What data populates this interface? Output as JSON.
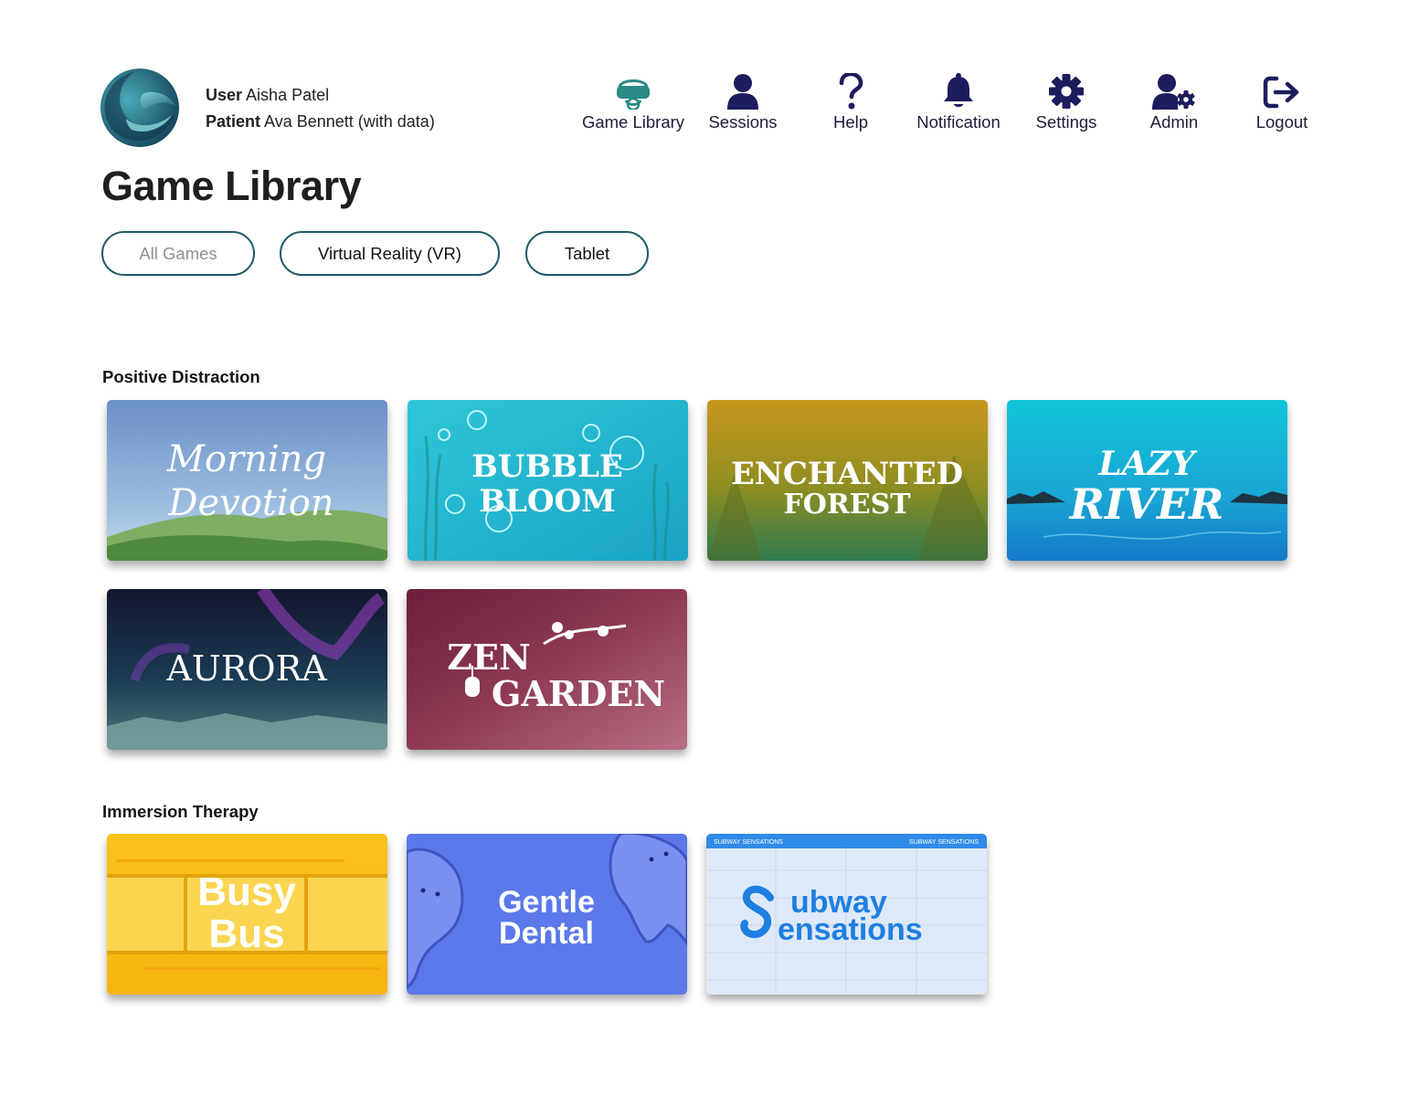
{
  "header": {
    "user_label": "User",
    "user_name": "Aisha Patel",
    "patient_label": "Patient",
    "patient_name": "Ava Bennett (with data)"
  },
  "nav": [
    {
      "label": "Game Library",
      "icon": "vr-headset-icon",
      "active": true,
      "color": "#2a8a86"
    },
    {
      "label": "Sessions",
      "icon": "user-icon"
    },
    {
      "label": "Help",
      "icon": "question-icon"
    },
    {
      "label": "Notification",
      "icon": "bell-icon"
    },
    {
      "label": "Settings",
      "icon": "gear-icon"
    },
    {
      "label": "Admin",
      "icon": "user-gear-icon"
    },
    {
      "label": "Logout",
      "icon": "logout-icon"
    }
  ],
  "page_title": "Game Library",
  "filters": [
    {
      "label": "All Games",
      "state": "inactive"
    },
    {
      "label": "Virtual Reality (VR)",
      "state": "active"
    },
    {
      "label": "Tablet",
      "state": "active"
    }
  ],
  "sections": [
    {
      "title": "Positive Distraction",
      "games": [
        {
          "title_line1": "Morning",
          "title_line2": "Devotion"
        },
        {
          "title_line1": "BUBBLE",
          "title_line2": "BLOOM"
        },
        {
          "title_line1": "ENCHANTED",
          "title_line2": "FOREST"
        },
        {
          "title_line1": "LAZY",
          "title_line2": "RIVER"
        },
        {
          "title_line1": "AURORA"
        },
        {
          "title_line1": "ZEN",
          "title_line2": "GARDEN"
        }
      ]
    },
    {
      "title": "Immersion Therapy",
      "games": [
        {
          "title_line1": "Busy",
          "title_line2": "Bus"
        },
        {
          "title_line1": "Gentle",
          "title_line2": "Dental"
        },
        {
          "title_line1": "ubway",
          "title_line2": "ensations",
          "banner_left": "SUBWAY SENSATIONS",
          "banner_right": "SUBWAY SENSATIONS"
        }
      ]
    }
  ],
  "colors": {
    "accent": "#1e5a66",
    "nav_icon": "#1c1c5e",
    "nav_active": "#2a8a86"
  }
}
